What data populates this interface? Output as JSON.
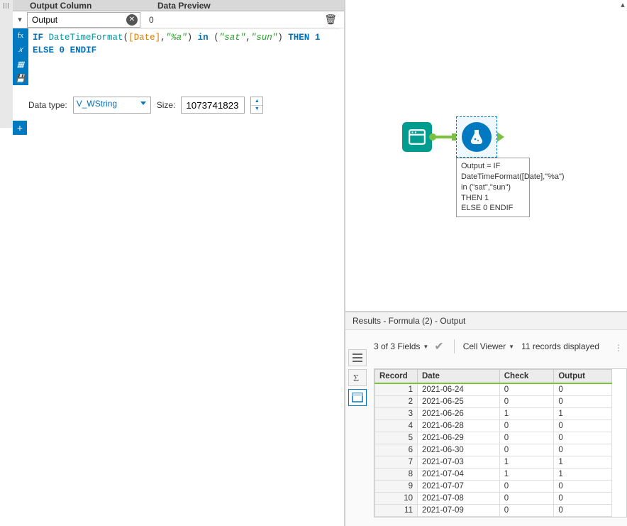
{
  "config": {
    "header_col1": "Output Column",
    "header_col2": "Data Preview",
    "output_name": "Output",
    "preview_value": "0",
    "formula_parts": {
      "if": "IF",
      "fn": "DateTimeFormat",
      "lp1": "(",
      "field": "[Date]",
      "comma1": ",",
      "fmtstr": "\"%a\"",
      "rp1": ")",
      "in": "in",
      "lp2": "(",
      "s1": "\"sat\"",
      "comma2": ",",
      "s2": "\"sun\"",
      "rp2": ")",
      "then": "THEN",
      "one": "1",
      "else": "ELSE",
      "zero": "0",
      "endif": "ENDIF"
    },
    "data_type_label": "Data type:",
    "data_type_value": "V_WString",
    "size_label": "Size:",
    "size_value": "1073741823"
  },
  "canvas": {
    "annotation_text": "Output = IF DateTimeFormat([Date],\"%a\") in (\"sat\",\"sun\") THEN 1\nELSE 0 ENDIF"
  },
  "results": {
    "title": "Results - Formula (2) - Output",
    "fields_text": "3 of 3 Fields",
    "cellviewer": "Cell Viewer",
    "records_text": "11 records displayed",
    "columns": [
      "Record",
      "Date",
      "Check",
      "Output"
    ],
    "rows": [
      {
        "rec": "1",
        "date": "2021-06-24",
        "check": "0",
        "output": "0"
      },
      {
        "rec": "2",
        "date": "2021-06-25",
        "check": "0",
        "output": "0"
      },
      {
        "rec": "3",
        "date": "2021-06-26",
        "check": "1",
        "output": "1"
      },
      {
        "rec": "4",
        "date": "2021-06-28",
        "check": "0",
        "output": "0"
      },
      {
        "rec": "5",
        "date": "2021-06-29",
        "check": "0",
        "output": "0"
      },
      {
        "rec": "6",
        "date": "2021-06-30",
        "check": "0",
        "output": "0"
      },
      {
        "rec": "7",
        "date": "2021-07-03",
        "check": "1",
        "output": "1"
      },
      {
        "rec": "8",
        "date": "2021-07-04",
        "check": "1",
        "output": "1"
      },
      {
        "rec": "9",
        "date": "2021-07-07",
        "check": "0",
        "output": "0"
      },
      {
        "rec": "10",
        "date": "2021-07-08",
        "check": "0",
        "output": "0"
      },
      {
        "rec": "11",
        "date": "2021-07-09",
        "check": "0",
        "output": "0"
      }
    ]
  }
}
